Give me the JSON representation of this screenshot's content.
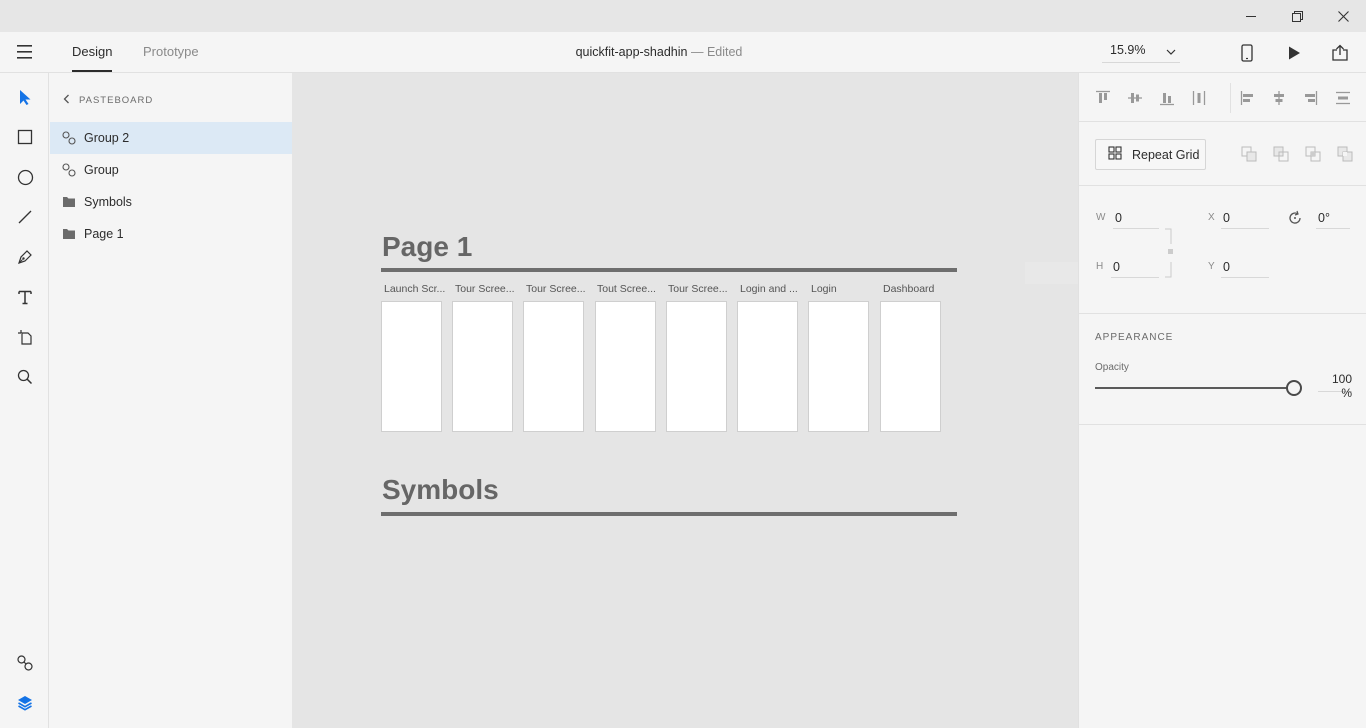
{
  "header": {
    "tabs": [
      {
        "label": "Design",
        "active": true
      },
      {
        "label": "Prototype",
        "active": false
      }
    ],
    "doc_name": "quickfit-app-shadhin",
    "doc_separator": "—",
    "doc_status": "Edited",
    "zoom": "15.9%",
    "icons": [
      "hamburger-menu-icon",
      "device-preview-icon",
      "play-icon",
      "share-icon"
    ]
  },
  "window_controls": [
    "minimize-icon",
    "restore-icon",
    "close-icon"
  ],
  "tools": [
    "select-tool",
    "rectangle-tool",
    "ellipse-tool",
    "line-tool",
    "pen-tool",
    "text-tool",
    "artboard-tool",
    "zoom-tool",
    "symbols-panel",
    "layers-panel"
  ],
  "layers": {
    "breadcrumb": "PASTEBOARD",
    "items": [
      {
        "label": "Group 2",
        "icon": "group-icon",
        "selected": true
      },
      {
        "label": "Group",
        "icon": "group-icon",
        "selected": false
      },
      {
        "label": "Symbols",
        "icon": "folder-icon",
        "selected": false
      },
      {
        "label": "Page 1",
        "icon": "folder-icon",
        "selected": false
      }
    ]
  },
  "canvas": {
    "page_title": "Page 1",
    "symbols_title": "Symbols",
    "artboards": [
      {
        "label": "Launch Scr..."
      },
      {
        "label": "Tour Scree..."
      },
      {
        "label": "Tour Scree..."
      },
      {
        "label": "Tout Scree..."
      },
      {
        "label": "Tour Scree..."
      },
      {
        "label": "Login and ..."
      },
      {
        "label": "Login"
      },
      {
        "label": "Dashboard"
      }
    ]
  },
  "properties": {
    "repeat_grid": "Repeat Grid",
    "w_label": "W",
    "w_value": "0",
    "h_label": "H",
    "h_value": "0",
    "x_label": "X",
    "x_value": "0",
    "y_label": "Y",
    "y_value": "0",
    "rotation": "0°",
    "appearance_title": "APPEARANCE",
    "opacity_label": "Opacity",
    "opacity_value": "100 %",
    "opacity_level": 1.0
  },
  "colors": {
    "accent": "#1473e6",
    "selected_row": "#dce9f5",
    "canvas_bg": "#e5e5e5",
    "panel_bg": "#f5f5f5"
  }
}
